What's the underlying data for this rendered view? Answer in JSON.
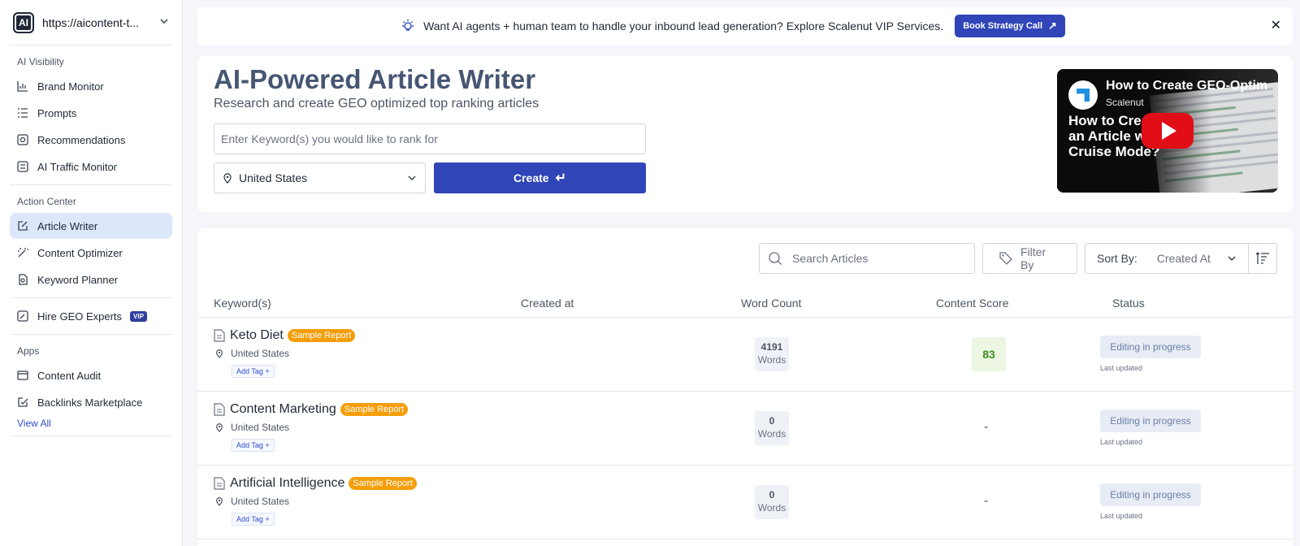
{
  "workspace": {
    "url": "https://aicontent-t...",
    "logo_text": "AI"
  },
  "sidebar": {
    "sections": [
      {
        "title": "AI Visibility",
        "items": [
          "Brand Monitor",
          "Prompts",
          "Recommendations",
          "AI Traffic Monitor"
        ]
      },
      {
        "title": "Action Center",
        "items": [
          "Article Writer",
          "Content Optimizer",
          "Keyword Planner"
        ]
      },
      {
        "hire": "Hire GEO Experts",
        "vip": "VIP"
      },
      {
        "title": "Apps",
        "items": [
          "Content Audit",
          "Backlinks Marketplace"
        ],
        "view_all": "View All"
      }
    ],
    "active_item": "Article Writer"
  },
  "banner": {
    "text": "Want AI agents + human team to handle your inbound lead generation? Explore Scalenut VIP Services.",
    "cta": "Book Strategy Call",
    "close": "✕"
  },
  "hero": {
    "title": "AI-Powered Article Writer",
    "subtitle": "Research and create GEO optimized top ranking articles",
    "keyword_placeholder": "Enter Keyword(s) you would like to rank for",
    "keyword_value": "",
    "country": "United States",
    "create_label": "Create",
    "enter_glyph": "↵"
  },
  "video": {
    "title": "How to Create GEO-Optim",
    "author": "Scalenut",
    "overlay_lines": [
      "How to Crea",
      "an Article w",
      "Cruise Mode?"
    ]
  },
  "articles": {
    "search_placeholder": "Search Articles",
    "filter_label": "Filter By",
    "sort_label": "Sort By:",
    "sort_value": "Created At",
    "columns": [
      "Keyword(s)",
      "Created at",
      "Word Count",
      "Content Score",
      "Status"
    ],
    "rows": [
      {
        "keyword": "Keto Diet",
        "badge": "Sample Report",
        "location": "United States",
        "add_tag": "Add Tag +",
        "created_at": "",
        "word_count": "4191",
        "words_label": "Words",
        "score": "83",
        "status": "Editing in progress",
        "updated": "Last updated"
      },
      {
        "keyword": "Content Marketing",
        "badge": "Sample Report",
        "location": "United States",
        "add_tag": "Add Tag +",
        "created_at": "",
        "word_count": "0",
        "words_label": "Words",
        "score": "-",
        "status": "Editing in progress",
        "updated": "Last updated"
      },
      {
        "keyword": "Artificial Intelligence",
        "badge": "Sample Report",
        "location": "United States",
        "add_tag": "Add Tag +",
        "created_at": "",
        "word_count": "0",
        "words_label": "Words",
        "score": "-",
        "status": "Editing in progress",
        "updated": "Last updated"
      }
    ]
  },
  "colors": {
    "primary": "#2f45b8",
    "active_nav": "#dce7fb",
    "badge": "#f59e0b",
    "score_good": "#3f8f20",
    "title": "#465673"
  },
  "icons": [
    "chart-bar-icon",
    "list-icon",
    "target-icon",
    "traffic-icon",
    "pen-square-icon",
    "wand-icon",
    "key-icon",
    "user-pen-icon",
    "audit-icon",
    "link-icon",
    "bulb-icon",
    "arrow-up-right-icon",
    "close-icon",
    "pin-icon",
    "chevron-down-icon",
    "enter-icon",
    "search-icon",
    "tag-icon",
    "sort-icon",
    "document-icon",
    "play-icon"
  ]
}
